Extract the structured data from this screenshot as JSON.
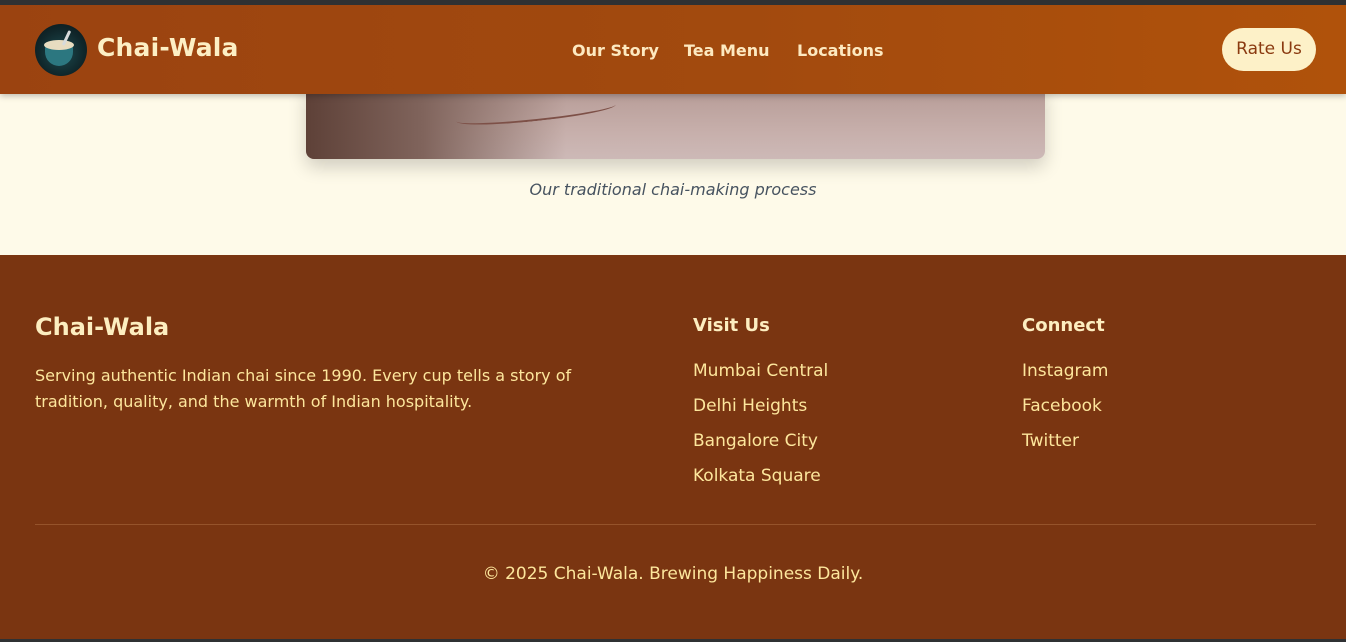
{
  "header": {
    "brand": "Chai-Wala",
    "nav": [
      "Our Story",
      "Tea Menu",
      "Locations"
    ],
    "cta": "Rate Us"
  },
  "gallery": {
    "caption": "Our traditional chai-making process"
  },
  "footer": {
    "brand": "Chai-Wala",
    "about": "Serving authentic Indian chai since 1990. Every cup tells a story of tradition, quality, and the warmth of Indian hospitality.",
    "visit_heading": "Visit Us",
    "locations": [
      "Mumbai Central",
      "Delhi Heights",
      "Bangalore City",
      "Kolkata Square"
    ],
    "connect_heading": "Connect",
    "social": [
      "Instagram",
      "Facebook",
      "Twitter"
    ],
    "copyright": "© 2025 Chai-Wala. Brewing Happiness Daily."
  },
  "colors": {
    "header_bg": "#a24a0e",
    "footer_bg": "#7a3511",
    "page_bg": "#fefae9",
    "accent_text": "#fde69c",
    "button_bg": "#fdf1c8"
  },
  "icons": {
    "logo": "chai-cup-logo"
  }
}
